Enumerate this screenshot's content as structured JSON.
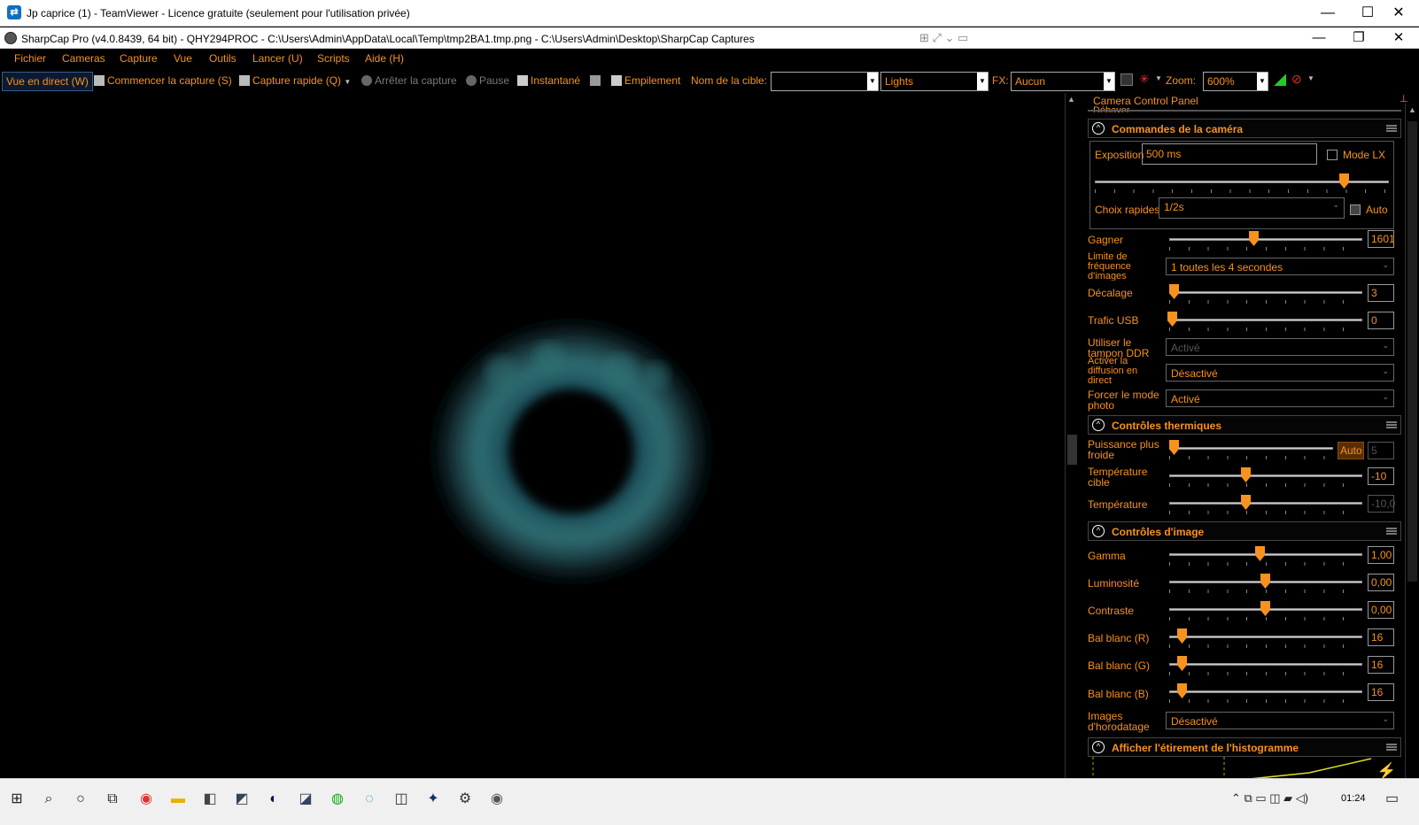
{
  "teamviewer": {
    "title": "Jp caprice (1) - TeamViewer - Licence gratuite (seulement pour l'utilisation privée)",
    "min": "—",
    "max": "☐",
    "close": "✕"
  },
  "sharpcap": {
    "title": "SharpCap Pro (v4.0.8439, 64 bit) - QHY294PROC - C:\\Users\\Admin\\AppData\\Local\\Temp\\tmp2BA1.tmp.png - C:\\Users\\Admin\\Desktop\\SharpCap Captures",
    "min": "—",
    "max": "❐",
    "close": "✕"
  },
  "menu": [
    "Fichier",
    "Cameras",
    "Capture",
    "Vue",
    "Outils",
    "Lancer (U)",
    "Scripts",
    "Aide (H)"
  ],
  "toolbar": {
    "live_view": "Vue en direct (W)",
    "start_capture": "Commencer la capture (S)",
    "quick_capture": "Capture rapide (Q)",
    "stop_capture": "Arrêter la capture",
    "pause": "Pause",
    "snapshot": "Instantané",
    "stacking": "Empilement",
    "target_label": "Nom de la cible:",
    "target_value": "",
    "frame_type": "Lights",
    "fx_label": "FX:",
    "fx_value": "Aucun",
    "zoom_label": "Zoom:",
    "zoom_value": "600%"
  },
  "panel": {
    "title": "Camera Control Panel",
    "partial_row": "Débayer",
    "camera_section": "Commandes de la caméra",
    "exposure_label": "Exposition",
    "exposure_value": "500 ms",
    "lx_mode": "Mode LX",
    "quick_choice_label": "Choix rapides",
    "quick_choice_value": "1/2s",
    "auto": "Auto",
    "gain_label": "Gagner",
    "gain_value": "1601",
    "frame_rate_label": "Limite de fréquence d'images",
    "frame_rate_value": "1 toutes les 4 secondes",
    "offset_label": "Décalage",
    "offset_value": "3",
    "usb_label": "Trafic USB",
    "usb_value": "0",
    "ddr_label": "Utiliser le tampon DDR",
    "ddr_value": "Activé",
    "live_stream_label": "Activer la diffusion en direct",
    "live_stream_value": "Désactivé",
    "photo_mode_label": "Forcer le mode photo",
    "photo_mode_value": "Activé",
    "thermal_section": "Contrôles thermiques",
    "cooler_power_label": "Puissance plus froide",
    "cooler_auto": "Auto",
    "cooler_value": "5",
    "target_temp_label": "Température cible",
    "target_temp_value": "-10",
    "temp_label": "Température",
    "temp_value": "-10,0",
    "image_section": "Contrôles d'image",
    "gamma_label": "Gamma",
    "gamma_value": "1,00",
    "brightness_label": "Luminosité",
    "brightness_value": "0,00",
    "contrast_label": "Contraste",
    "contrast_value": "0,00",
    "wb_r_label": "Bal blanc (R)",
    "wb_r_value": "16",
    "wb_g_label": "Bal blanc (G)",
    "wb_g_value": "16",
    "wb_b_label": "Bal blanc (B)",
    "wb_b_value": "16",
    "timestamp_label": "Images d'horodatage",
    "timestamp_value": "Désactivé",
    "histogram_section": "Afficher l'étirement de l'histogramme"
  },
  "taskbar": {
    "time": "01:24"
  },
  "colors": {
    "accent": "#f7921e",
    "background": "#000000"
  }
}
